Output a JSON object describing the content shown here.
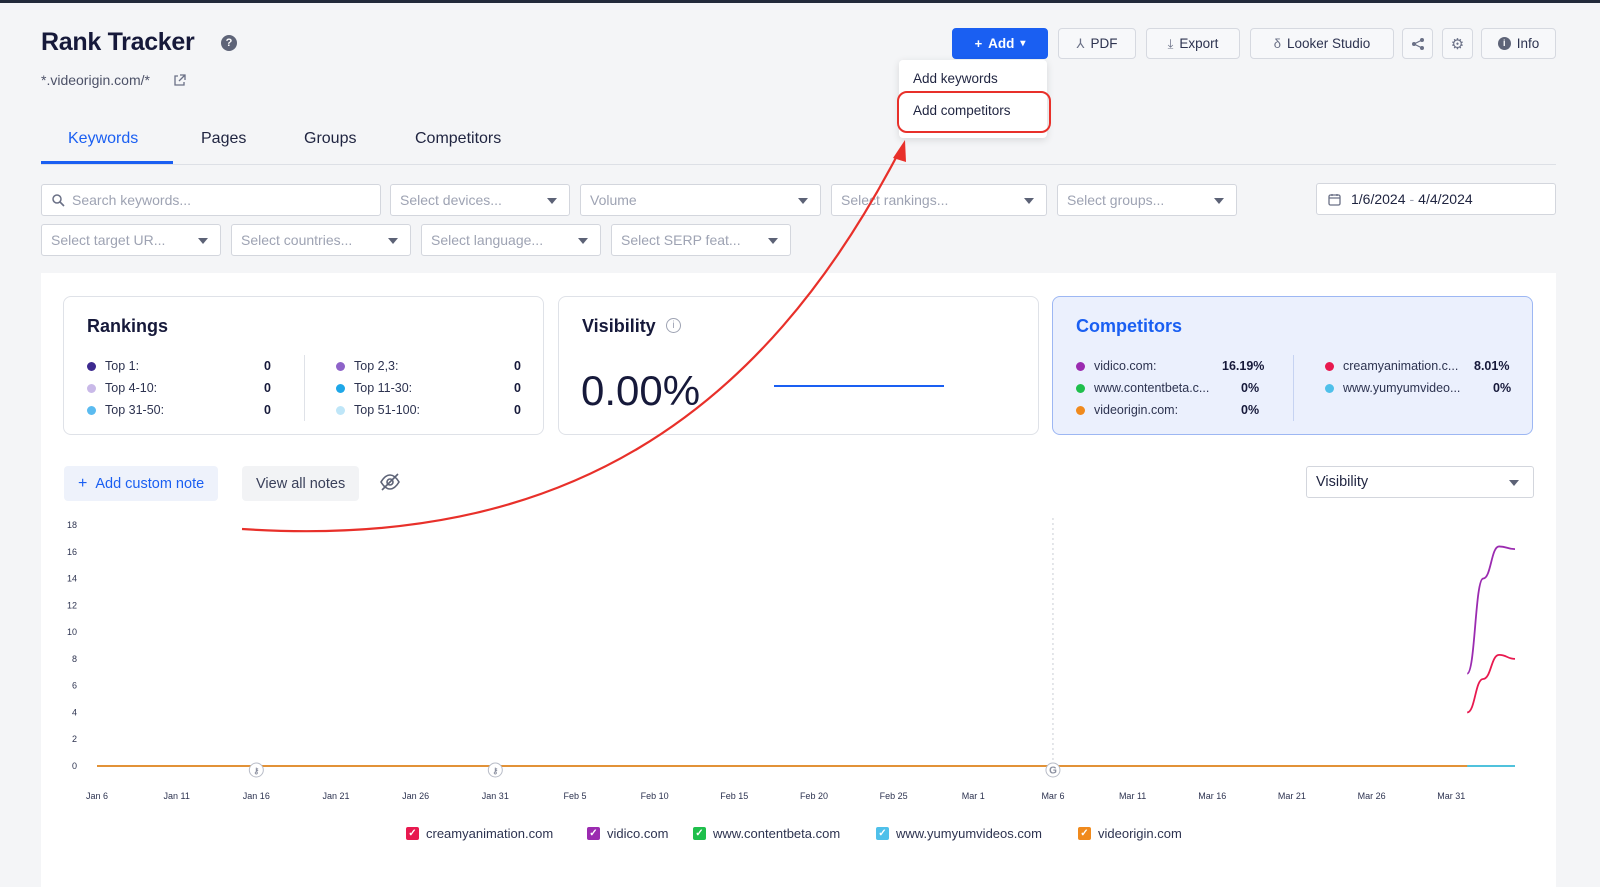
{
  "header": {
    "title": "Rank Tracker",
    "help_glyph": "?",
    "domain": "*.videorigin.com/*"
  },
  "toolbar": {
    "add_label": "Add",
    "pdf_label": "PDF",
    "export_label": "Export",
    "looker_label": "Looker Studio",
    "info_label": "Info"
  },
  "add_menu": {
    "items": [
      "Add keywords",
      "Add competitors"
    ],
    "highlighted": "Add competitors"
  },
  "tabs": [
    {
      "label": "Keywords",
      "active": true
    },
    {
      "label": "Pages",
      "active": false
    },
    {
      "label": "Groups",
      "active": false
    },
    {
      "label": "Competitors",
      "active": false
    }
  ],
  "filters": {
    "search_placeholder": "Search keywords...",
    "devices": "Select devices...",
    "volume": "Volume",
    "rankings": "Select rankings...",
    "groups": "Select groups...",
    "date_start": "1/6/2024",
    "date_sep": "-",
    "date_end": "4/4/2024",
    "target_url": "Select target UR...",
    "countries": "Select countries...",
    "language": "Select language...",
    "serp": "Select SERP feat..."
  },
  "rankings": {
    "title": "Rankings",
    "left": [
      {
        "label": "Top 1:",
        "value": "0",
        "color": "#3d2a8f"
      },
      {
        "label": "Top 4-10:",
        "value": "0",
        "color": "#c9b9e8"
      },
      {
        "label": "Top 31-50:",
        "value": "0",
        "color": "#5bbbf0"
      }
    ],
    "right": [
      {
        "label": "Top 2,3:",
        "value": "0",
        "color": "#8e63c9"
      },
      {
        "label": "Top 11-30:",
        "value": "0",
        "color": "#1ea7e8"
      },
      {
        "label": "Top 51-100:",
        "value": "0",
        "color": "#bfe6f8"
      }
    ]
  },
  "visibility": {
    "title": "Visibility",
    "info_glyph": "i",
    "value": "0.00%"
  },
  "competitors": {
    "title": "Competitors",
    "left": [
      {
        "label": "vidico.com:",
        "value": "16.19%",
        "color": "#9b2bb0"
      },
      {
        "label": "www.contentbeta.c...",
        "value": "0%",
        "color": "#1fbf4c"
      },
      {
        "label": "videorigin.com:",
        "value": "0%",
        "color": "#f08a1d"
      }
    ],
    "right": [
      {
        "label": "creamyanimation.c...",
        "value": "8.01%",
        "color": "#e8194f"
      },
      {
        "label": "www.yumyumvideo...",
        "value": "0%",
        "color": "#4fc0ea"
      }
    ]
  },
  "notes": {
    "add_label": "Add custom note",
    "view_label": "View all notes"
  },
  "metric_select": "Visibility",
  "chart_data": {
    "type": "line",
    "ylim": [
      0,
      18
    ],
    "y_ticks": [
      "0",
      "2",
      "4",
      "6",
      "8",
      "10",
      "12",
      "14",
      "16",
      "18"
    ],
    "x_ticks": [
      "Jan 6",
      "Jan 11",
      "Jan 16",
      "Jan 21",
      "Jan 26",
      "Jan 31",
      "Feb 5",
      "Feb 10",
      "Feb 15",
      "Feb 20",
      "Feb 25",
      "Mar 1",
      "Mar 6",
      "Mar 11",
      "Mar 16",
      "Mar 21",
      "Mar 26",
      "Mar 31"
    ],
    "x_dates": [
      "2024-01-06",
      "2024-04-04"
    ],
    "series": [
      {
        "name": "creamyanimation.com",
        "color": "#e8194f",
        "points": [
          [
            "2024-04-01",
            4.0
          ],
          [
            "2024-04-02",
            6.5
          ],
          [
            "2024-04-03",
            8.3
          ],
          [
            "2024-04-04",
            8.0
          ]
        ]
      },
      {
        "name": "vidico.com",
        "color": "#9b2bb0",
        "points": [
          [
            "2024-04-01",
            6.9
          ],
          [
            "2024-04-02",
            14.0
          ],
          [
            "2024-04-03",
            16.4
          ],
          [
            "2024-04-04",
            16.2
          ]
        ]
      },
      {
        "name": "www.contentbeta.com",
        "color": "#1fbf4c",
        "points": [
          [
            "2024-04-01",
            0
          ],
          [
            "2024-04-04",
            0
          ]
        ]
      },
      {
        "name": "www.yumyumvideos.com",
        "color": "#4fc0ea",
        "points": [
          [
            "2024-01-06",
            0
          ],
          [
            "2024-04-04",
            0
          ]
        ]
      },
      {
        "name": "videorigin.com",
        "color": "#f08a1d",
        "points": [
          [
            "2024-01-06",
            0
          ],
          [
            "2024-04-01",
            0
          ]
        ]
      }
    ],
    "markers": [
      {
        "date": "2024-01-16",
        "glyph": "key"
      },
      {
        "date": "2024-01-31",
        "glyph": "key"
      },
      {
        "date": "2024-03-06",
        "glyph": "G"
      }
    ],
    "vertical_guide": "2024-03-06"
  }
}
